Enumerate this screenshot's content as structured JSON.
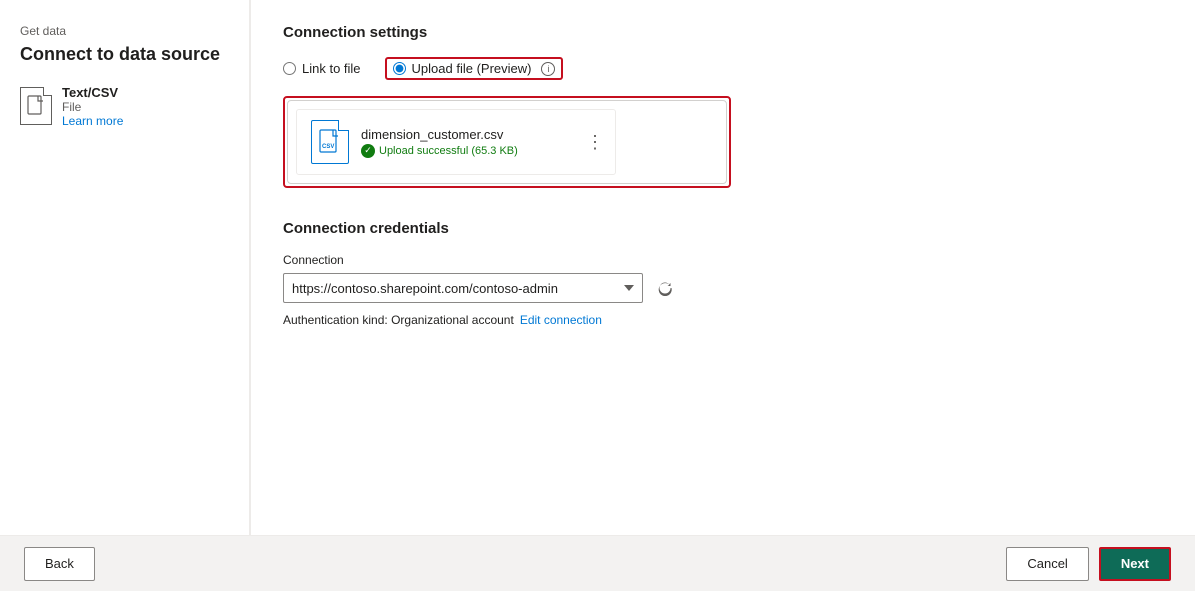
{
  "header": {
    "breadcrumb": "Get data",
    "title": "Connect to data source"
  },
  "sidebar": {
    "source_name": "Text/CSV",
    "source_type": "File",
    "learn_more_label": "Learn more"
  },
  "connection_settings": {
    "section_title": "Connection settings",
    "radio_link": "Link to file",
    "radio_upload": "Upload file (Preview)",
    "file_name": "dimension_customer.csv",
    "upload_status": "Upload successful (65.3 KB)",
    "more_options": "⋮"
  },
  "connection_credentials": {
    "section_title": "Connection credentials",
    "connection_label": "Connection",
    "connection_value": "https://contoso.sharepoint.com/contoso-admin",
    "auth_text": "Authentication kind: Organizational account",
    "edit_link": "Edit connection"
  },
  "footer": {
    "back_label": "Back",
    "cancel_label": "Cancel",
    "next_label": "Next"
  }
}
